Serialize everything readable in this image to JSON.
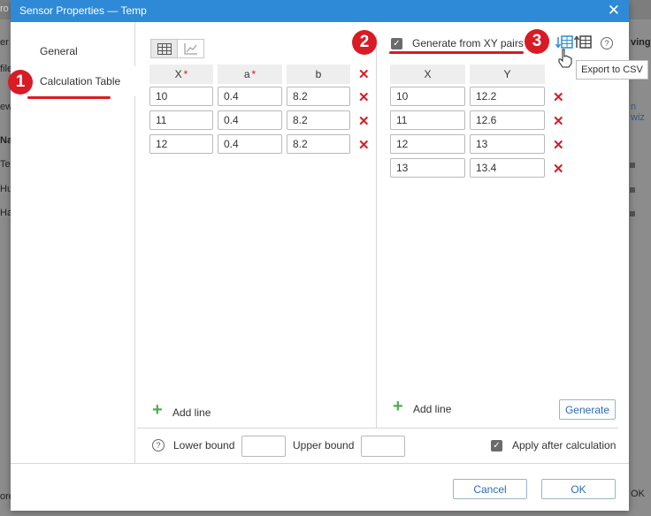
{
  "background": {
    "fragments": [
      "ro",
      "er",
      "file",
      "ew",
      "Na",
      "Te",
      "Hu",
      "Ha",
      "ving",
      "n wiz",
      "ore",
      "OK"
    ]
  },
  "dialog": {
    "title": "Sensor Properties — Temp",
    "close_glyph": "✕"
  },
  "nav": {
    "general": "General",
    "calculation_table": "Calculation Table"
  },
  "badges": {
    "b1": "1",
    "b2": "2",
    "b3": "3"
  },
  "left_table": {
    "headers": {
      "x": "X",
      "a": "a",
      "b": "b"
    },
    "rows": [
      {
        "x": "10",
        "a": "0.4",
        "b": "8.2"
      },
      {
        "x": "11",
        "a": "0.4",
        "b": "8.2"
      },
      {
        "x": "12",
        "a": "0.4",
        "b": "8.2"
      }
    ],
    "add_line": "Add line"
  },
  "right_table": {
    "generate_label": "Generate from XY pairs",
    "generate_checked": true,
    "headers": {
      "x": "X",
      "y": "Y"
    },
    "rows": [
      {
        "x": "10",
        "y": "12.2"
      },
      {
        "x": "11",
        "y": "12.6"
      },
      {
        "x": "12",
        "y": "13"
      },
      {
        "x": "13",
        "y": "13.4"
      }
    ],
    "add_line": "Add line",
    "generate_button": "Generate",
    "tooltip": "Export to CSV"
  },
  "bounds": {
    "lower_label": "Lower bound",
    "upper_label": "Upper bound",
    "lower_value": "",
    "upper_value": "",
    "apply_label": "Apply after calculation",
    "apply_checked": true
  },
  "footer": {
    "cancel": "Cancel",
    "ok": "OK"
  },
  "colors": {
    "accent": "#2e8ad6",
    "badge": "#d81b24",
    "delete": "#d81b24",
    "add": "#4caf50"
  }
}
